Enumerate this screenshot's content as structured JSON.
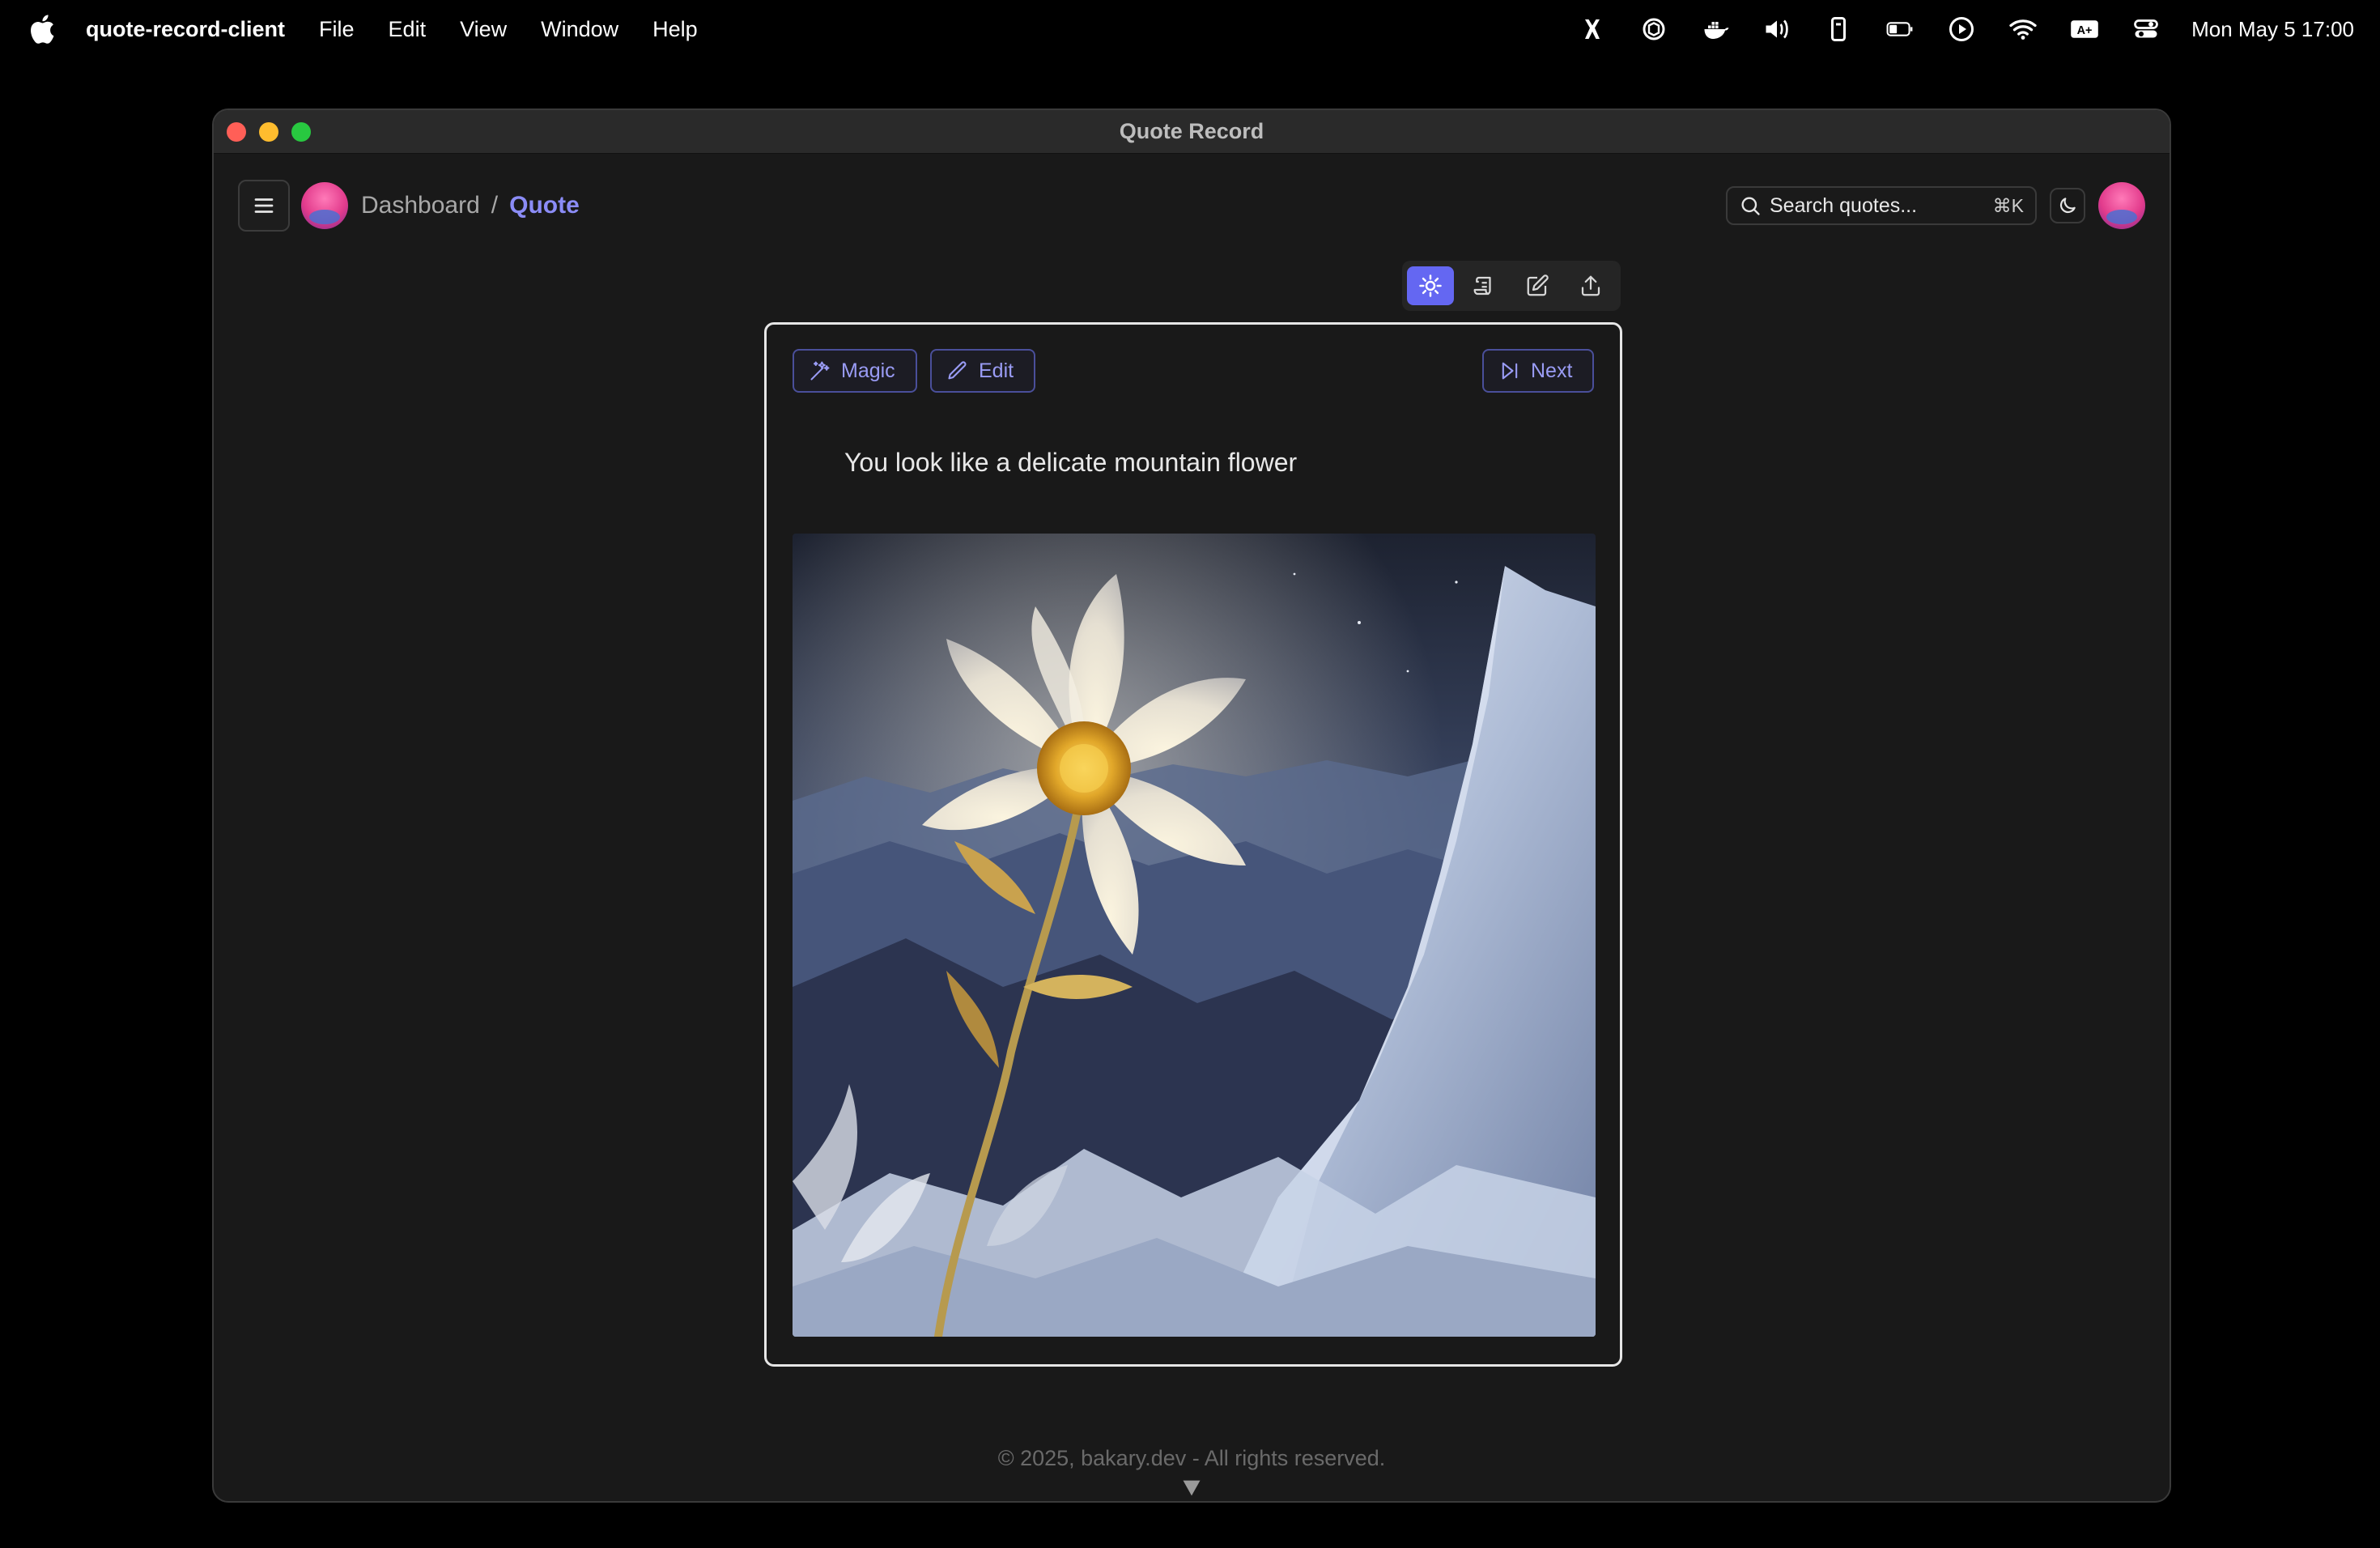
{
  "menubar": {
    "app_name": "quote-record-client",
    "items": [
      "File",
      "Edit",
      "View",
      "Window",
      "Help"
    ],
    "clock": "Mon May 5  17:00",
    "status_icons": [
      "stage-manager-icon",
      "chatgpt-icon",
      "docker-icon",
      "volume-icon",
      "phone-icon",
      "battery-icon",
      "play-icon",
      "wifi-icon",
      "accessibility-text-icon",
      "control-center-icon"
    ]
  },
  "window": {
    "title": "Quote Record"
  },
  "nav": {
    "breadcrumb": [
      "Dashboard",
      "Quote"
    ],
    "separator": "/",
    "search_placeholder": "Search quotes...",
    "search_shortcut": "⌘K"
  },
  "toolbar": {
    "tools": [
      "sun-icon",
      "scroll-icon",
      "edit-icon",
      "share-icon"
    ],
    "active_index": 0
  },
  "card": {
    "magic_label": "Magic",
    "edit_label": "Edit",
    "next_label": "Next",
    "quote": "You look like a delicate mountain flower"
  },
  "footer": {
    "text": "© 2025, bakary.dev - All rights reserved."
  },
  "colors": {
    "accent": "#6467f2",
    "accent_text": "#8b8cf6",
    "background": "#191919"
  }
}
